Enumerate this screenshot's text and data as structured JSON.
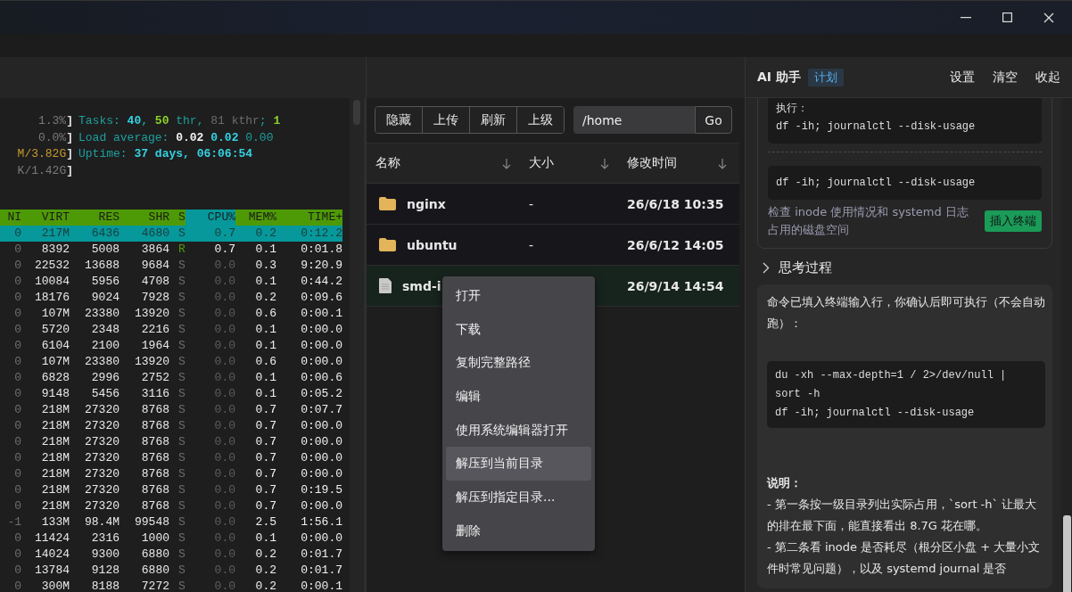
{
  "terminal": {
    "summary": [
      {
        "meter": [
          {
            "text": "1.3%",
            "color": "#7a7a7a",
            "bold": false
          },
          {
            "text": "]",
            "color": "#e6e6e6",
            "bold": true
          }
        ],
        "info": [
          {
            "text": "Tasks: ",
            "color": "#1f9e9e",
            "bold": false
          },
          {
            "text": "40",
            "color": "#35d3e3",
            "bold": true
          },
          {
            "text": ", ",
            "color": "#1f9e9e",
            "bold": true
          },
          {
            "text": "50",
            "color": "#8bd42a",
            "bold": true
          },
          {
            "text": " thr, ",
            "color": "#1f9e9e",
            "bold": false
          },
          {
            "text": "81 kthr",
            "color": "#6b6b6b",
            "bold": false
          },
          {
            "text": "; ",
            "color": "#1f9e9e",
            "bold": false
          },
          {
            "text": "1",
            "color": "#8bd42a",
            "bold": true
          }
        ]
      },
      {
        "meter": [
          {
            "text": "0.0%",
            "color": "#7a7a7a",
            "bold": false
          },
          {
            "text": "]",
            "color": "#e6e6e6",
            "bold": true
          }
        ],
        "info": [
          {
            "text": "Load average: ",
            "color": "#1f9e9e",
            "bold": false
          },
          {
            "text": "0.02 ",
            "color": "#f2f2f2",
            "bold": true
          },
          {
            "text": "0.02 ",
            "color": "#35d3e3",
            "bold": true
          },
          {
            "text": "0.00",
            "color": "#1f9e9e",
            "bold": false
          }
        ]
      },
      {
        "meter": [
          {
            "text": "M/3.82G",
            "color": "#c89a2c",
            "bold": false
          },
          {
            "text": "]",
            "color": "#e6e6e6",
            "bold": true
          }
        ],
        "info": [
          {
            "text": "Uptime: ",
            "color": "#1f9e9e",
            "bold": false
          },
          {
            "text": "37 days, 06:06:54",
            "color": "#35d3e3",
            "bold": true
          }
        ]
      },
      {
        "meter": [
          {
            "text": "K/1.42G",
            "color": "#7a7a7a",
            "bold": false
          },
          {
            "text": "]",
            "color": "#e6e6e6",
            "bold": true
          }
        ]
      }
    ],
    "columns": [
      {
        "label": "NI",
        "sorted": false
      },
      {
        "label": "VIRT",
        "sorted": false
      },
      {
        "label": "RES",
        "sorted": false
      },
      {
        "label": "SHR",
        "sorted": false
      },
      {
        "label": "S",
        "sorted": false
      },
      {
        "label": "CPU%",
        "sorted": true
      },
      {
        "label": "MEM%",
        "sorted": false
      },
      {
        "label": "TIME+",
        "sorted": false
      }
    ],
    "processes": [
      {
        "cells": [
          "0",
          "217M",
          "6436",
          "4680",
          "S",
          "0.7",
          "0.2",
          "0:12.2"
        ],
        "selected": true,
        "running": false
      },
      {
        "cells": [
          "0",
          "8392",
          "5008",
          "3864",
          "R",
          "0.7",
          "0.1",
          "0:01.8"
        ],
        "selected": false,
        "running": true
      },
      {
        "cells": [
          "0",
          "22532",
          "13688",
          "9684",
          "S",
          "0.0",
          "0.3",
          "9:20.9"
        ],
        "selected": false,
        "running": false
      },
      {
        "cells": [
          "0",
          "10084",
          "5956",
          "4708",
          "S",
          "0.0",
          "0.1",
          "0:44.2"
        ],
        "selected": false,
        "running": false
      },
      {
        "cells": [
          "0",
          "18176",
          "9024",
          "7928",
          "S",
          "0.0",
          "0.2",
          "0:09.6"
        ],
        "selected": false,
        "running": false
      },
      {
        "cells": [
          "0",
          "107M",
          "23380",
          "13920",
          "S",
          "0.0",
          "0.6",
          "0:00.1"
        ],
        "selected": false,
        "running": false
      },
      {
        "cells": [
          "0",
          "5720",
          "2348",
          "2216",
          "S",
          "0.0",
          "0.1",
          "0:00.0"
        ],
        "selected": false,
        "running": false
      },
      {
        "cells": [
          "0",
          "6104",
          "2100",
          "1964",
          "S",
          "0.0",
          "0.1",
          "0:00.0"
        ],
        "selected": false,
        "running": false
      },
      {
        "cells": [
          "0",
          "107M",
          "23380",
          "13920",
          "S",
          "0.0",
          "0.6",
          "0:00.0"
        ],
        "selected": false,
        "running": false
      },
      {
        "cells": [
          "0",
          "6828",
          "2996",
          "2752",
          "S",
          "0.0",
          "0.1",
          "0:00.6"
        ],
        "selected": false,
        "running": false
      },
      {
        "cells": [
          "0",
          "9148",
          "5456",
          "3116",
          "S",
          "0.0",
          "0.1",
          "0:05.2"
        ],
        "selected": false,
        "running": false
      },
      {
        "cells": [
          "0",
          "218M",
          "27320",
          "8768",
          "S",
          "0.0",
          "0.7",
          "0:07.7"
        ],
        "selected": false,
        "running": false
      },
      {
        "cells": [
          "0",
          "218M",
          "27320",
          "8768",
          "S",
          "0.0",
          "0.7",
          "0:00.0"
        ],
        "selected": false,
        "running": false
      },
      {
        "cells": [
          "0",
          "218M",
          "27320",
          "8768",
          "S",
          "0.0",
          "0.7",
          "0:00.0"
        ],
        "selected": false,
        "running": false
      },
      {
        "cells": [
          "0",
          "218M",
          "27320",
          "8768",
          "S",
          "0.0",
          "0.7",
          "0:00.0"
        ],
        "selected": false,
        "running": false
      },
      {
        "cells": [
          "0",
          "218M",
          "27320",
          "8768",
          "S",
          "0.0",
          "0.7",
          "0:00.0"
        ],
        "selected": false,
        "running": false
      },
      {
        "cells": [
          "0",
          "218M",
          "27320",
          "8768",
          "S",
          "0.0",
          "0.7",
          "0:19.5"
        ],
        "selected": false,
        "running": false
      },
      {
        "cells": [
          "0",
          "218M",
          "27320",
          "8768",
          "S",
          "0.0",
          "0.7",
          "0:00.0"
        ],
        "selected": false,
        "running": false
      },
      {
        "cells": [
          "-1",
          "133M",
          "98.4M",
          "99548",
          "S",
          "0.0",
          "2.5",
          "1:56.1"
        ],
        "selected": false,
        "running": false
      },
      {
        "cells": [
          "0",
          "11424",
          "2316",
          "1000",
          "S",
          "0.0",
          "0.1",
          "0:00.0"
        ],
        "selected": false,
        "running": false
      },
      {
        "cells": [
          "0",
          "14024",
          "9300",
          "6880",
          "S",
          "0.0",
          "0.2",
          "0:01.7"
        ],
        "selected": false,
        "running": false
      },
      {
        "cells": [
          "0",
          "13784",
          "9128",
          "6880",
          "S",
          "0.0",
          "0.2",
          "0:01.7"
        ],
        "selected": false,
        "running": false
      },
      {
        "cells": [
          "0",
          "300M",
          "8188",
          "7272",
          "S",
          "0.0",
          "0.2",
          "0:00.1"
        ],
        "selected": false,
        "running": false
      }
    ]
  },
  "file_manager": {
    "toolbar": [
      "隐藏",
      "上传",
      "刷新",
      "上级"
    ],
    "path": "/home",
    "go": "Go",
    "columns": [
      "名称",
      "大小",
      "修改时间"
    ],
    "files": [
      {
        "name": "nginx",
        "size": "-",
        "modified": "26/6/18 10:35",
        "kind": "folder",
        "selected": false
      },
      {
        "name": "ubuntu",
        "size": "-",
        "modified": "26/6/12 14:05",
        "kind": "folder",
        "selected": false
      },
      {
        "name": "smd-i",
        "modified": "26/9/14 14:54",
        "kind": "file",
        "selected": true
      }
    ],
    "context_menu": [
      {
        "label": "打开",
        "highlighted": false
      },
      {
        "label": "下载",
        "highlighted": false
      },
      {
        "label": "复制完整路径",
        "highlighted": false
      },
      {
        "label": "编辑",
        "highlighted": false
      },
      {
        "label": "使用系统编辑器打开",
        "highlighted": false
      },
      {
        "label": "解压到当前目录",
        "highlighted": true
      },
      {
        "label": "解压到指定目录...",
        "highlighted": false
      },
      {
        "label": "删除",
        "highlighted": false
      }
    ]
  },
  "assistant": {
    "title": "AI 助手",
    "mode": "计划",
    "actions": [
      "设置",
      "清空",
      "收起"
    ],
    "plan_card": {
      "step_label": "执行：",
      "command": "df -ih; journalctl --disk-usage",
      "alt_command": "df -ih; journalctl --disk-usage",
      "description": "检查 inode 使用情况和 systemd 日志占用的磁盘空间",
      "insert_button": "插入终端"
    },
    "thinking": {
      "label": "思考过程",
      "expanded": false
    },
    "message": {
      "intro": "命令已填入终端输入行，你确认后即可执行（不会自动跑）：",
      "code": [
        "du -xh --max-depth=1 / 2>/dev/null | sort -h",
        "df -ih; journalctl --disk-usage"
      ],
      "note_title": "说明：",
      "notes": [
        "- 第一条按一级目录列出实际占用，`sort -h` 让最大的排在最下面，能直接看出 8.7G 花在哪。",
        "- 第二条看 inode 是否耗尽（根分区小盘 + 大量小文件时常见问题），以及 systemd journal 是否"
      ]
    }
  }
}
